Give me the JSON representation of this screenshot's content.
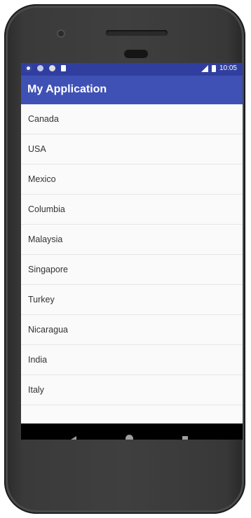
{
  "status_bar": {
    "time": "10:05",
    "icons": [
      "settings-icon",
      "wifi-icon",
      "circle-icon",
      "sd-card-icon",
      "signal-icon",
      "battery-icon"
    ]
  },
  "app_bar": {
    "title": "My Application"
  },
  "countries": [
    "Canada",
    "USA",
    "Mexico",
    "Columbia",
    "Malaysia",
    "Singapore",
    "Turkey",
    "Nicaragua",
    "India",
    "Italy"
  ],
  "colors": {
    "primary": "#3f51b5",
    "primary_dark": "#303f9f",
    "background": "#fafafa"
  },
  "nav_bar": {
    "buttons": [
      "back-icon",
      "home-icon",
      "recents-icon"
    ]
  }
}
